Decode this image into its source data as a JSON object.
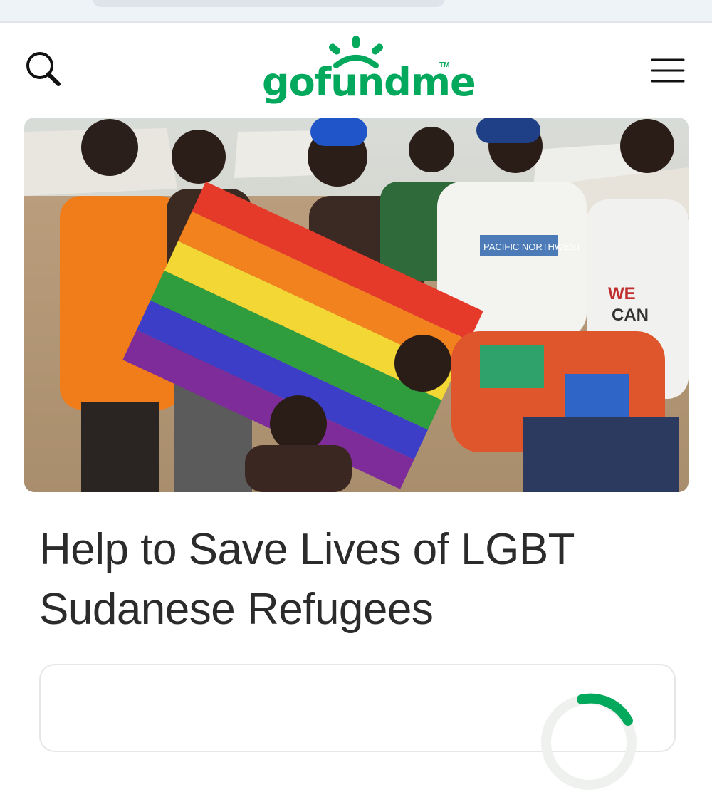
{
  "header": {
    "logo_text": "gofundme",
    "logo_tm": "TM",
    "search_icon": "search-icon",
    "menu_icon": "hamburger-menu-icon"
  },
  "hero_image": {
    "alt": "Group of young people holding a rainbow flag",
    "shirt_text_1": "PACIFIC NORTHWEST",
    "shirt_text_2": "WE CAN"
  },
  "campaign": {
    "title": "Help to Save Lives of LGBT Sudanese Refugees"
  },
  "colors": {
    "brand": "#02a95c",
    "title": "#2b2b2b",
    "browser_bar": "#eef3f8"
  }
}
